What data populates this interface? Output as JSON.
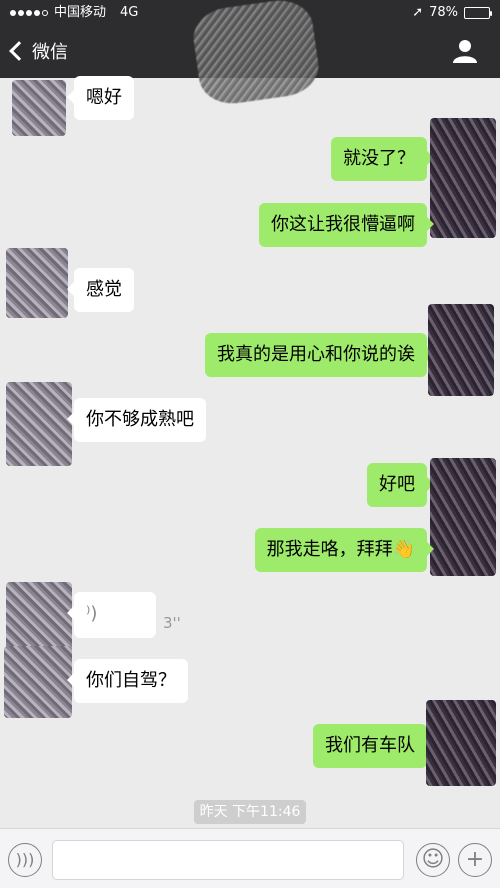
{
  "status": {
    "carrier": "中国移动",
    "network": "4G",
    "battery": "78%",
    "battery_level": 0.78
  },
  "nav": {
    "back_label": "微信"
  },
  "messages": [
    {
      "side": "left",
      "text": "嗯好"
    },
    {
      "side": "right",
      "text": "就没了？"
    },
    {
      "side": "right",
      "text": "你这让我很懵逼啊"
    },
    {
      "side": "left",
      "text": "感觉"
    },
    {
      "side": "right",
      "text": "我真的是用心和你说的诶"
    },
    {
      "side": "left",
      "text": "你不够成熟吧"
    },
    {
      "side": "right",
      "text": "好吧"
    },
    {
      "side": "right",
      "text": "那我走咯，拜拜👋"
    },
    {
      "side": "left",
      "voice_duration": "3''"
    },
    {
      "side": "left",
      "text": "你们自驾？"
    },
    {
      "side": "right",
      "text": "我们有车队"
    }
  ],
  "timestamp": "昨天 下午11:46",
  "input": {
    "placeholder": ""
  }
}
